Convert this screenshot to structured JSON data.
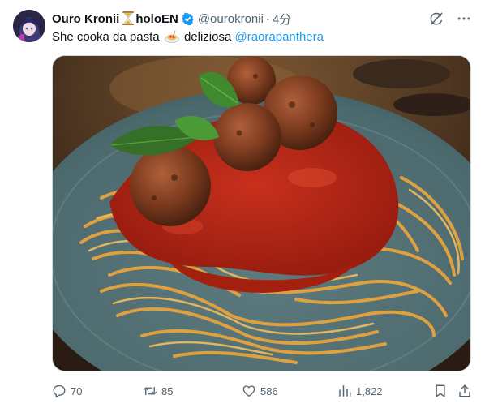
{
  "author": {
    "display_name": "Ouro Kronii",
    "affiliation": "holoEN",
    "handle": "@ourokronii",
    "separator": "·",
    "time": "4分"
  },
  "tweet": {
    "text_prefix": "She cooka da pasta",
    "text_suffix": "deliziosa",
    "mention": "@raorapanthera",
    "image_alt": "spaghetti with meatballs and basil on a teal plate"
  },
  "icons": {
    "verified": "verified-badge-icon",
    "grok": "grok-icon",
    "more": "more-icon",
    "hourglass": "hourglass-emoji",
    "dish": "spaghetti-emoji"
  },
  "metrics": {
    "replies": "70",
    "reposts": "85",
    "likes": "586",
    "views": "1,822"
  },
  "colors": {
    "accent": "#1d9bf0",
    "text": "#0f1419",
    "muted": "#536471"
  }
}
